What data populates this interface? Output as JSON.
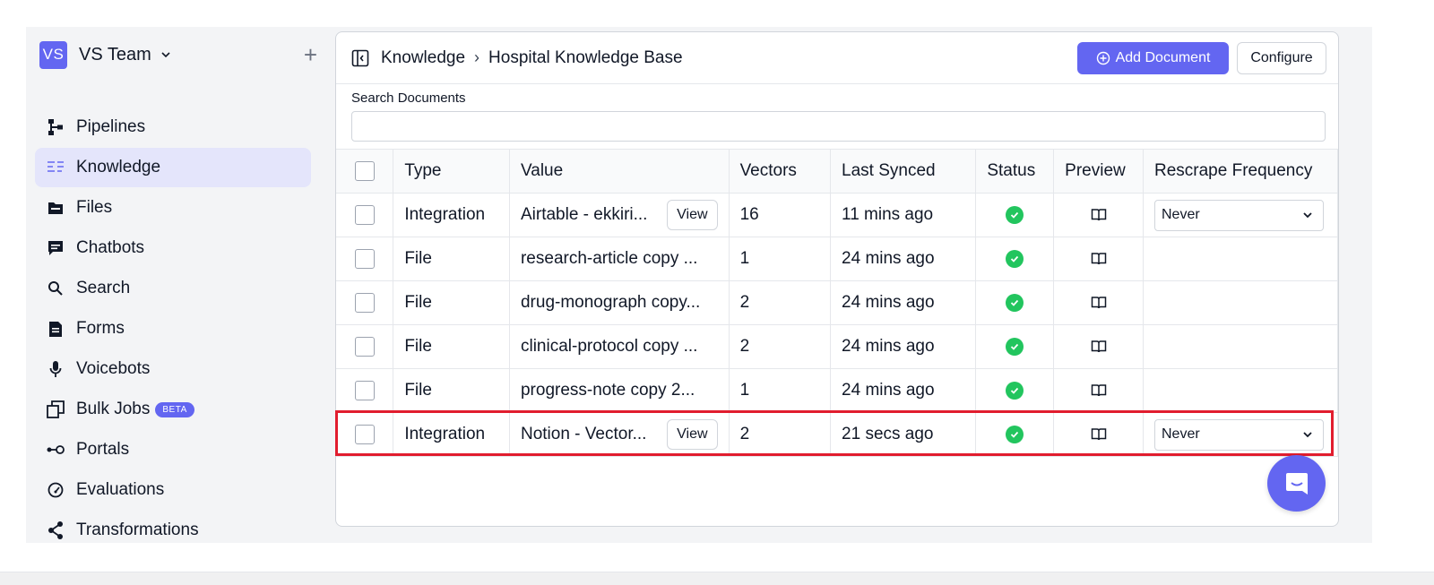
{
  "team": {
    "badge": "VS",
    "name": "VS Team"
  },
  "sidebar": {
    "items": [
      {
        "label": "Pipelines",
        "icon": "pipelines-icon"
      },
      {
        "label": "Knowledge",
        "icon": "knowledge-icon",
        "active": true
      },
      {
        "label": "Files",
        "icon": "folder-icon"
      },
      {
        "label": "Chatbots",
        "icon": "chat-icon"
      },
      {
        "label": "Search",
        "icon": "search-icon"
      },
      {
        "label": "Forms",
        "icon": "form-icon"
      },
      {
        "label": "Voicebots",
        "icon": "microphone-icon"
      },
      {
        "label": "Bulk Jobs",
        "icon": "copy-icon",
        "badge": "BETA"
      },
      {
        "label": "Portals",
        "icon": "portal-icon"
      },
      {
        "label": "Evaluations",
        "icon": "gauge-icon"
      },
      {
        "label": "Transformations",
        "icon": "share-icon"
      }
    ]
  },
  "header": {
    "breadcrumb": [
      "Knowledge",
      "Hospital Knowledge Base"
    ],
    "separator": "›",
    "add_label": "Add Document",
    "configure_label": "Configure"
  },
  "search": {
    "label": "Search Documents",
    "placeholder": ""
  },
  "table": {
    "columns": [
      "Type",
      "Value",
      "Vectors",
      "Last Synced",
      "Status",
      "Preview",
      "Rescrape Frequency"
    ],
    "rows": [
      {
        "type": "Integration",
        "value": "Airtable - ekkiri...",
        "view": "View",
        "vectors": "16",
        "synced": "11 mins ago",
        "frequency": "Never"
      },
      {
        "type": "File",
        "value": "research-article copy ...",
        "vectors": "1",
        "synced": "24 mins ago"
      },
      {
        "type": "File",
        "value": "drug-monograph copy...",
        "vectors": "2",
        "synced": "24 mins ago"
      },
      {
        "type": "File",
        "value": "clinical-protocol copy ...",
        "vectors": "2",
        "synced": "24 mins ago"
      },
      {
        "type": "File",
        "value": "progress-note copy 2...",
        "vectors": "1",
        "synced": "24 mins ago"
      },
      {
        "type": "Integration",
        "value": "Notion - Vector...",
        "view": "View",
        "vectors": "2",
        "synced": "21 secs ago",
        "frequency": "Never",
        "highlighted": true
      }
    ]
  },
  "colors": {
    "accent": "#6366f1",
    "status_ok": "#22c55e",
    "highlight": "#e11d2e",
    "active_nav": "#e4e5fb"
  }
}
